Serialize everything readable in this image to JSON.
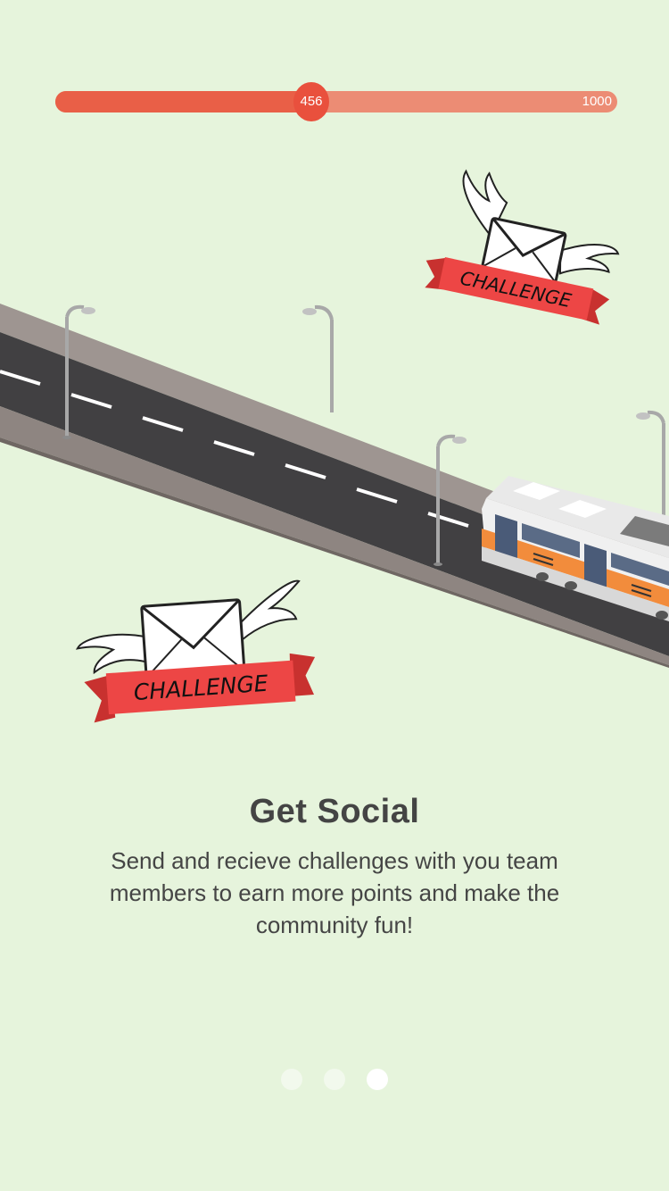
{
  "progress": {
    "value": 456,
    "max": 1000,
    "value_label": "456",
    "max_label": "1000"
  },
  "illustration": {
    "badge_text": "CHALLENGE"
  },
  "content": {
    "title": "Get Social",
    "description": "Send and recieve challenges with you team members to earn more points and make the community fun!"
  },
  "pager": {
    "count": 3,
    "active_index": 2
  },
  "colors": {
    "background": "#e6f4dc",
    "progress_fill": "#e95f47",
    "progress_track": "#ec8c74",
    "ribbon": "#e8403e"
  }
}
